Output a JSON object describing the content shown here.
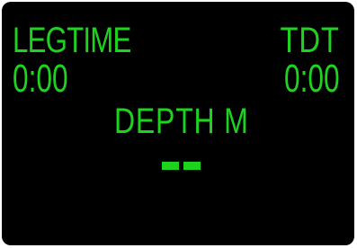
{
  "display": {
    "legtime_label": "LEGTIME",
    "legtime_value": "0:00",
    "tdt_label": "TDT",
    "tdt_value": "0:00",
    "depth_label": "DEPTH M",
    "depth_value": "--"
  },
  "colors": {
    "screen_background": "#000000",
    "segment_text": "#1ed31e"
  }
}
